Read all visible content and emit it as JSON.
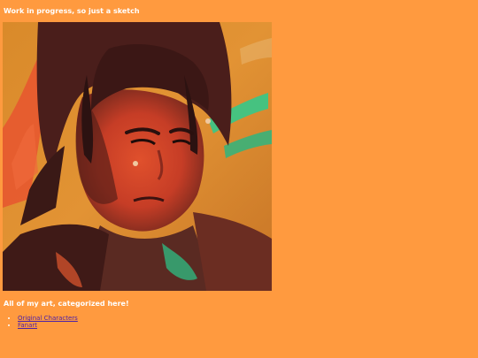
{
  "page": {
    "background": "#ff9a3f",
    "wip_heading": "Work in progress, so just a sketch",
    "artwork": {
      "alt": "Painted sketch of a person with dark hair on a colorful background"
    },
    "categories_heading": "All of my art, categorized here!",
    "categories": [
      {
        "label": "Original Characters"
      },
      {
        "label": "Fanart"
      }
    ],
    "link_color": "#4b1fa8"
  }
}
